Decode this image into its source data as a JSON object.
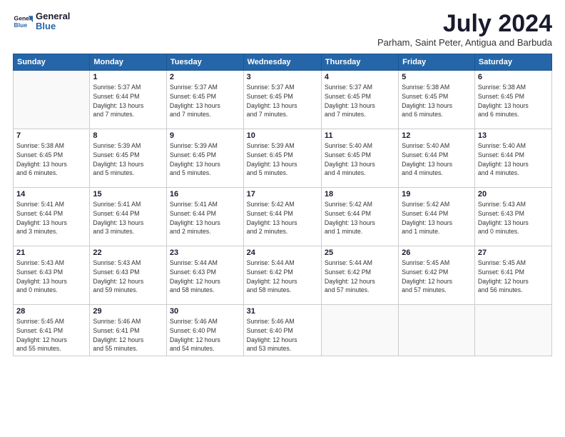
{
  "logo": {
    "line1": "General",
    "line2": "Blue"
  },
  "title": "July 2024",
  "subtitle": "Parham, Saint Peter, Antigua and Barbuda",
  "header_days": [
    "Sunday",
    "Monday",
    "Tuesday",
    "Wednesday",
    "Thursday",
    "Friday",
    "Saturday"
  ],
  "weeks": [
    [
      {
        "day": "",
        "detail": ""
      },
      {
        "day": "1",
        "detail": "Sunrise: 5:37 AM\nSunset: 6:44 PM\nDaylight: 13 hours\nand 7 minutes."
      },
      {
        "day": "2",
        "detail": "Sunrise: 5:37 AM\nSunset: 6:45 PM\nDaylight: 13 hours\nand 7 minutes."
      },
      {
        "day": "3",
        "detail": "Sunrise: 5:37 AM\nSunset: 6:45 PM\nDaylight: 13 hours\nand 7 minutes."
      },
      {
        "day": "4",
        "detail": "Sunrise: 5:37 AM\nSunset: 6:45 PM\nDaylight: 13 hours\nand 7 minutes."
      },
      {
        "day": "5",
        "detail": "Sunrise: 5:38 AM\nSunset: 6:45 PM\nDaylight: 13 hours\nand 6 minutes."
      },
      {
        "day": "6",
        "detail": "Sunrise: 5:38 AM\nSunset: 6:45 PM\nDaylight: 13 hours\nand 6 minutes."
      }
    ],
    [
      {
        "day": "7",
        "detail": "Sunrise: 5:38 AM\nSunset: 6:45 PM\nDaylight: 13 hours\nand 6 minutes."
      },
      {
        "day": "8",
        "detail": "Sunrise: 5:39 AM\nSunset: 6:45 PM\nDaylight: 13 hours\nand 5 minutes."
      },
      {
        "day": "9",
        "detail": "Sunrise: 5:39 AM\nSunset: 6:45 PM\nDaylight: 13 hours\nand 5 minutes."
      },
      {
        "day": "10",
        "detail": "Sunrise: 5:39 AM\nSunset: 6:45 PM\nDaylight: 13 hours\nand 5 minutes."
      },
      {
        "day": "11",
        "detail": "Sunrise: 5:40 AM\nSunset: 6:45 PM\nDaylight: 13 hours\nand 4 minutes."
      },
      {
        "day": "12",
        "detail": "Sunrise: 5:40 AM\nSunset: 6:44 PM\nDaylight: 13 hours\nand 4 minutes."
      },
      {
        "day": "13",
        "detail": "Sunrise: 5:40 AM\nSunset: 6:44 PM\nDaylight: 13 hours\nand 4 minutes."
      }
    ],
    [
      {
        "day": "14",
        "detail": "Sunrise: 5:41 AM\nSunset: 6:44 PM\nDaylight: 13 hours\nand 3 minutes."
      },
      {
        "day": "15",
        "detail": "Sunrise: 5:41 AM\nSunset: 6:44 PM\nDaylight: 13 hours\nand 3 minutes."
      },
      {
        "day": "16",
        "detail": "Sunrise: 5:41 AM\nSunset: 6:44 PM\nDaylight: 13 hours\nand 2 minutes."
      },
      {
        "day": "17",
        "detail": "Sunrise: 5:42 AM\nSunset: 6:44 PM\nDaylight: 13 hours\nand 2 minutes."
      },
      {
        "day": "18",
        "detail": "Sunrise: 5:42 AM\nSunset: 6:44 PM\nDaylight: 13 hours\nand 1 minute."
      },
      {
        "day": "19",
        "detail": "Sunrise: 5:42 AM\nSunset: 6:44 PM\nDaylight: 13 hours\nand 1 minute."
      },
      {
        "day": "20",
        "detail": "Sunrise: 5:43 AM\nSunset: 6:43 PM\nDaylight: 13 hours\nand 0 minutes."
      }
    ],
    [
      {
        "day": "21",
        "detail": "Sunrise: 5:43 AM\nSunset: 6:43 PM\nDaylight: 13 hours\nand 0 minutes."
      },
      {
        "day": "22",
        "detail": "Sunrise: 5:43 AM\nSunset: 6:43 PM\nDaylight: 12 hours\nand 59 minutes."
      },
      {
        "day": "23",
        "detail": "Sunrise: 5:44 AM\nSunset: 6:43 PM\nDaylight: 12 hours\nand 58 minutes."
      },
      {
        "day": "24",
        "detail": "Sunrise: 5:44 AM\nSunset: 6:42 PM\nDaylight: 12 hours\nand 58 minutes."
      },
      {
        "day": "25",
        "detail": "Sunrise: 5:44 AM\nSunset: 6:42 PM\nDaylight: 12 hours\nand 57 minutes."
      },
      {
        "day": "26",
        "detail": "Sunrise: 5:45 AM\nSunset: 6:42 PM\nDaylight: 12 hours\nand 57 minutes."
      },
      {
        "day": "27",
        "detail": "Sunrise: 5:45 AM\nSunset: 6:41 PM\nDaylight: 12 hours\nand 56 minutes."
      }
    ],
    [
      {
        "day": "28",
        "detail": "Sunrise: 5:45 AM\nSunset: 6:41 PM\nDaylight: 12 hours\nand 55 minutes."
      },
      {
        "day": "29",
        "detail": "Sunrise: 5:46 AM\nSunset: 6:41 PM\nDaylight: 12 hours\nand 55 minutes."
      },
      {
        "day": "30",
        "detail": "Sunrise: 5:46 AM\nSunset: 6:40 PM\nDaylight: 12 hours\nand 54 minutes."
      },
      {
        "day": "31",
        "detail": "Sunrise: 5:46 AM\nSunset: 6:40 PM\nDaylight: 12 hours\nand 53 minutes."
      },
      {
        "day": "",
        "detail": ""
      },
      {
        "day": "",
        "detail": ""
      },
      {
        "day": "",
        "detail": ""
      }
    ]
  ]
}
